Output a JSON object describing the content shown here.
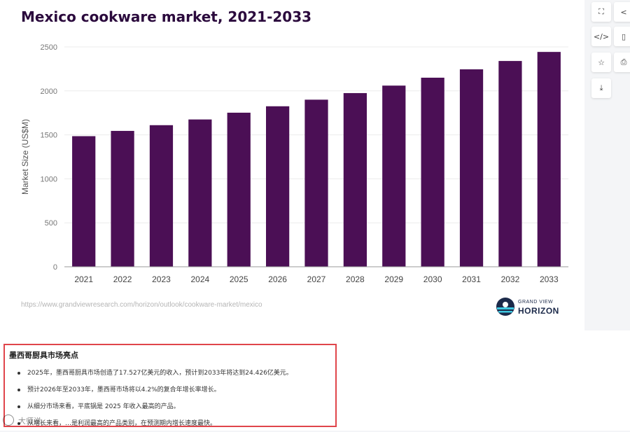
{
  "chart_data": {
    "type": "bar",
    "title": "Mexico cookware market, 2021-2033",
    "ylabel": "Market Size (US$M)",
    "xlabel": "",
    "categories": [
      "2021",
      "2022",
      "2023",
      "2024",
      "2025",
      "2026",
      "2027",
      "2028",
      "2029",
      "2030",
      "2031",
      "2032",
      "2033"
    ],
    "values": [
      1485,
      1545,
      1610,
      1675,
      1752,
      1825,
      1900,
      1975,
      2060,
      2150,
      2245,
      2340,
      2443
    ],
    "ylim": [
      0,
      2500
    ],
    "yticks": [
      0,
      500,
      1000,
      1500,
      2000,
      2500
    ],
    "grid": true,
    "bar_color": "#4b0f55"
  },
  "source": {
    "url": "https://www.grandviewresearch.com/horizon/outlook/cookware-market/mexico"
  },
  "logo": {
    "line1": "GRAND VIEW",
    "line2": "HORIZON",
    "colors": {
      "navy": "#1c2a4a",
      "cyan": "#3ec7e0"
    }
  },
  "tools": [
    {
      "name": "fullscreen-icon",
      "glyph": "⛶"
    },
    {
      "name": "share-icon",
      "glyph": "<"
    },
    {
      "name": "embed-code-icon",
      "glyph": "</>"
    },
    {
      "name": "document-icon",
      "glyph": "▯"
    },
    {
      "name": "star-icon",
      "glyph": "☆"
    },
    {
      "name": "print-icon",
      "glyph": "⎙"
    },
    {
      "name": "download-icon",
      "glyph": "⤓"
    }
  ],
  "highlights": {
    "title": "墨西哥厨具市场亮点",
    "items": [
      "2025年，墨西哥厨具市场创造了17.527亿美元的收入，预计到2033年将达到24.426亿美元。",
      "预计2026年至2033年，墨西哥市场将以4.2%的复合年增长率增长。",
      "从细分市场来看，平底锅是 2025 年收入最高的产品。",
      "从增长来看，…是利润最高的产品类别，在预测期内增长速度最快。"
    ],
    "border_color": "#e0454b"
  },
  "watermark": {
    "text": "大师说"
  }
}
